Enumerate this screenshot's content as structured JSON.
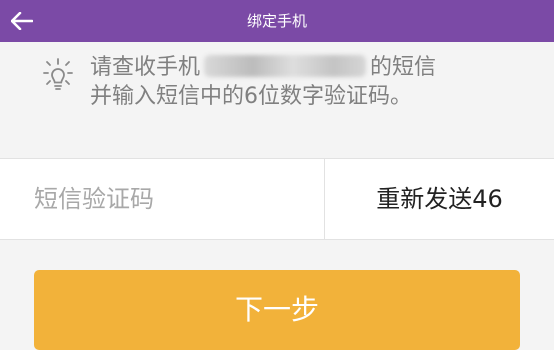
{
  "header": {
    "title": "绑定手机",
    "back_icon": "arrow-left-icon",
    "background": "#7b4aa6"
  },
  "notice": {
    "icon": "lightbulb-icon",
    "prefix": "请查收手机",
    "suffix": "的短信",
    "line2": "并输入短信中的6位数字验证码。"
  },
  "verification": {
    "placeholder": "短信验证码",
    "resend_label": "重新发送46"
  },
  "next_button": {
    "label": "下一步",
    "color": "#f2b23a"
  }
}
